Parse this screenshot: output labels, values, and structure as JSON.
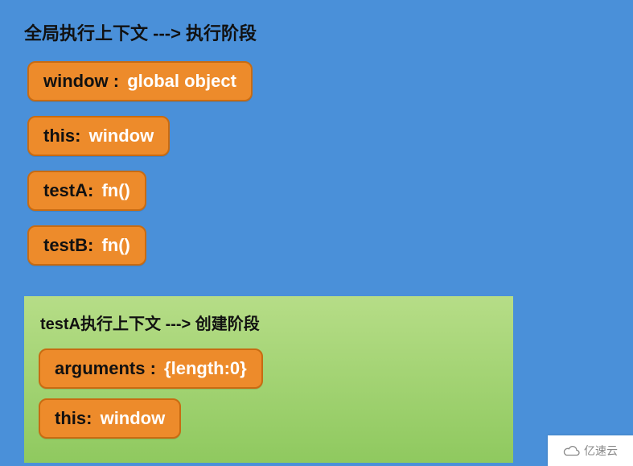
{
  "global": {
    "title": "全局执行上下文 ---> 执行阶段",
    "items": [
      {
        "key": "window ",
        "sep": ": ",
        "val": "global object"
      },
      {
        "key": "this",
        "sep": ": ",
        "val": "window"
      },
      {
        "key": "testA",
        "sep": ": ",
        "val": "fn()"
      },
      {
        "key": "testB",
        "sep": ": ",
        "val": "fn()"
      }
    ]
  },
  "sub": {
    "title": "testA执行上下文 ---> 创建阶段",
    "items": [
      {
        "key": "arguments ",
        "sep": ": ",
        "val": "{length:0}"
      },
      {
        "key": "this",
        "sep": ": ",
        "val": "window"
      }
    ]
  },
  "watermark": {
    "icon_name": "cloud-icon",
    "text": "亿速云"
  }
}
